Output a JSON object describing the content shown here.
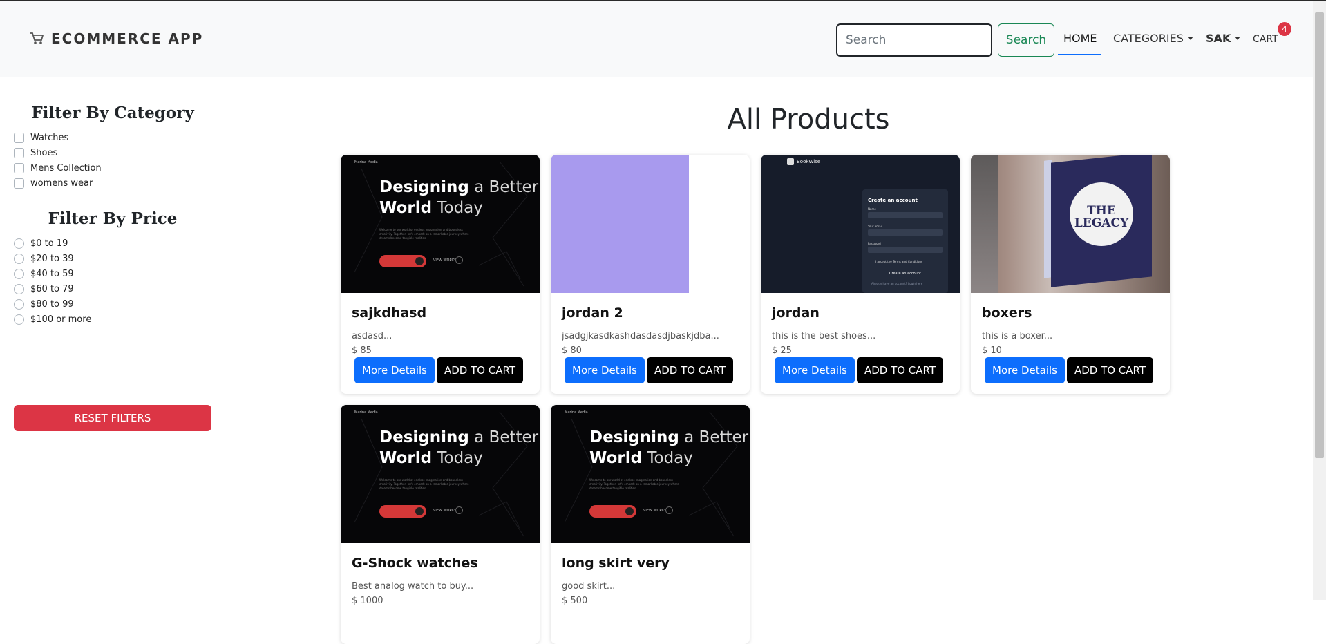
{
  "navbar": {
    "brand": "ECOMMERCE APP",
    "search_placeholder": "Search",
    "search_button": "Search",
    "home": "HOME",
    "categories": "CATEGORIES",
    "user": "SAK",
    "cart": "CART",
    "cart_count": "4"
  },
  "sidebar": {
    "category_title": "Filter By Category",
    "categories": [
      "Watches",
      "Shoes",
      "Mens Collection",
      "womens wear"
    ],
    "price_title": "Filter By Price",
    "prices": [
      "$0 to 19",
      "$20 to 39",
      "$40 to 59",
      "$60 to 79",
      "$80 to 99",
      "$100 or more"
    ],
    "reset_button": "RESET FILTERS"
  },
  "main": {
    "title": "All Products",
    "more_details_label": "More Details",
    "add_to_cart_label": "ADD TO CART",
    "products": [
      {
        "name": "sajkdhasd",
        "desc": "asdasd...",
        "price": "$ 85",
        "image": "design-hero"
      },
      {
        "name": "jordan 2",
        "desc": "jsadgjkasdkashdasdasdjbaskjdba...",
        "price": "$ 80",
        "image": "purple-square"
      },
      {
        "name": "jordan",
        "desc": "this is the best shoes...",
        "price": "$ 25",
        "image": "bookwise-signup"
      },
      {
        "name": "boxers",
        "desc": "this is a boxer...",
        "price": "$ 10",
        "image": "legacy-sign"
      },
      {
        "name": "G-Shock watches",
        "desc": "Best analog watch to buy...",
        "price": "$ 1000",
        "image": "design-hero"
      },
      {
        "name": "long skirt very",
        "desc": "good skirt...",
        "price": "$ 500",
        "image": "design-hero"
      }
    ]
  },
  "images": {
    "hero_logo": "Marina Media",
    "hero_heading_bold_1": "Designing",
    "hero_heading_thin_1": " a Better",
    "hero_heading_bold_2": "World",
    "hero_heading_thin_2": " Today",
    "hero_paragraph": "Welcome to our world of endless imagination and boundless creativity. Together, let's embark on a remarkable journey where dreams become tangible realities.",
    "hero_view": "VIEW WORKS",
    "bookwise_logo": "BookWise",
    "bookwise_title": "Create an account",
    "bookwise_name": "Name",
    "bookwise_email": "Your email",
    "bookwise_password": "Password",
    "bookwise_terms": "I accept the Terms and Conditions",
    "bookwise_button": "Create an account",
    "bookwise_login": "Already have an account? Login here",
    "legacy_text": "THE LEGACY"
  },
  "colors": {
    "primary": "#0d6efd",
    "danger": "#dc3545",
    "success": "#198754",
    "dark": "#000000"
  }
}
